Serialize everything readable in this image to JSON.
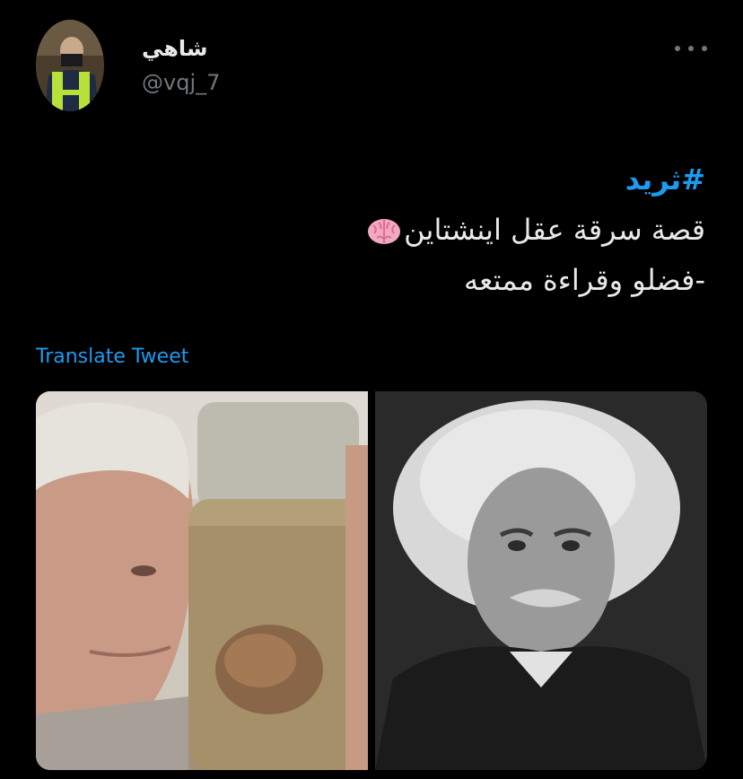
{
  "tweet": {
    "author": {
      "display_name": "شاهي",
      "handle": "@vqj_7",
      "avatar_icon": "profile-photo"
    },
    "more_icon": "more-horizontal-icon",
    "text": {
      "hashtag": "#ثريد",
      "line2": "قصة سرقة عقل اينشتاين",
      "line2_emoji": "brain-icon",
      "line3": "-فضلو وقراءة ممتعه"
    },
    "translate_label": "Translate Tweet",
    "media": {
      "photos": [
        "photo-scientist-holding-brain-jar",
        "photo-einstein-portrait"
      ]
    }
  },
  "colors": {
    "background": "#000000",
    "text": "#e7e9ea",
    "secondary": "#71767b",
    "accent": "#1d9bf0"
  }
}
